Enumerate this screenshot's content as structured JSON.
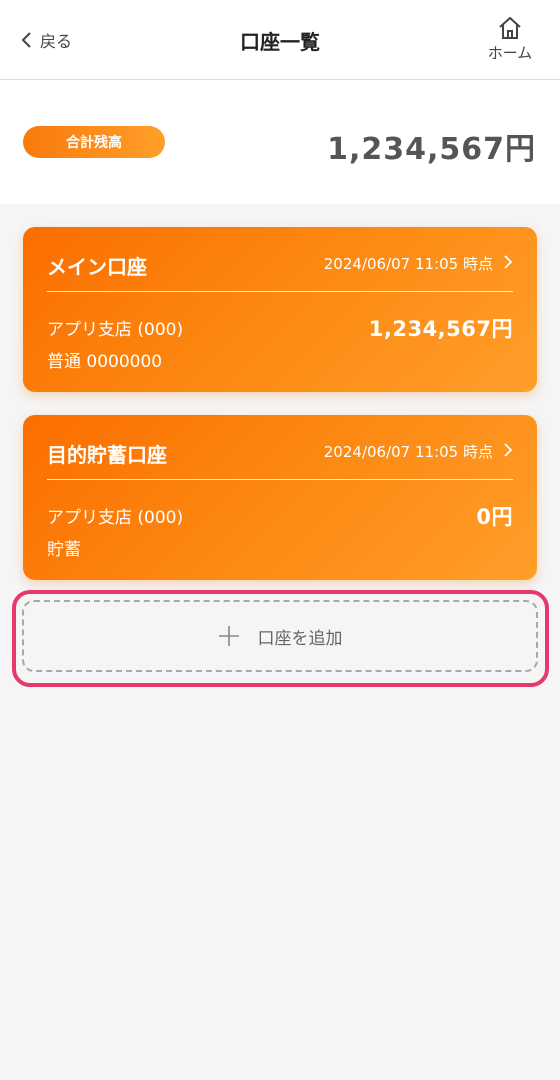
{
  "header": {
    "back_label": "戻る",
    "title": "口座一覧",
    "home_label": "ホーム"
  },
  "summary": {
    "badge_label": "合計残高",
    "total_amount": "1,234,567円"
  },
  "accounts": [
    {
      "name": "メイン口座",
      "timestamp": "2024/06/07 11:05 時点",
      "branch": "アプリ支店 (000)",
      "type_number": "普通 0000000",
      "balance": "1,234,567円"
    },
    {
      "name": "目的貯蓄口座",
      "timestamp": "2024/06/07 11:05 時点",
      "branch": "アプリ支店 (000)",
      "type_number": "貯蓄",
      "balance": "0円"
    }
  ],
  "add_account": {
    "label": "口座を追加"
  },
  "icons": {
    "back": "chevron-left-icon",
    "home": "home-icon",
    "card_arrow": "chevron-right-icon",
    "add": "plus-icon"
  },
  "colors": {
    "accent": "#fb7c0a",
    "highlight": "#e8386b"
  }
}
